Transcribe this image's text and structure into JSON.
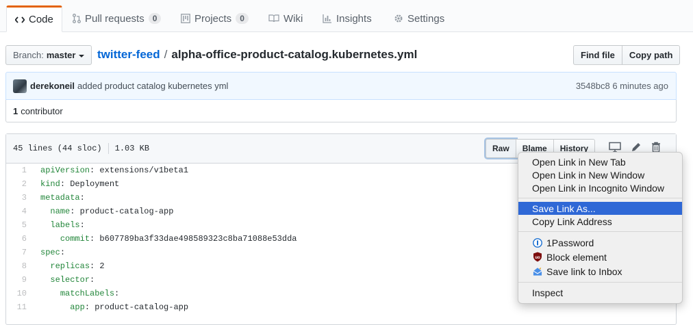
{
  "tabs": [
    {
      "label": "Code",
      "icon": "code-icon"
    },
    {
      "label": "Pull requests",
      "icon": "pull-request-icon",
      "count": "0"
    },
    {
      "label": "Projects",
      "icon": "project-icon",
      "count": "0"
    },
    {
      "label": "Wiki",
      "icon": "book-icon"
    },
    {
      "label": "Insights",
      "icon": "graph-icon"
    },
    {
      "label": "Settings",
      "icon": "gear-icon"
    }
  ],
  "branch": {
    "label": "Branch:",
    "value": "master"
  },
  "breadcrumb": {
    "repo": "twitter-feed",
    "separator": "/",
    "file": "alpha-office-product-catalog.kubernetes.yml"
  },
  "file_actions": {
    "find_file": "Find file",
    "copy_path": "Copy path"
  },
  "commit": {
    "author": "derekoneil",
    "message": "added product catalog kubernetes yml",
    "sha": "3548bc8",
    "time": "6 minutes ago"
  },
  "contributors": {
    "count": "1",
    "label": "contributor"
  },
  "file_info": {
    "lines": "45 lines (44 sloc)",
    "size": "1.03 KB"
  },
  "file_buttons": {
    "raw": "Raw",
    "blame": "Blame",
    "history": "History"
  },
  "code_lines": [
    {
      "n": "1",
      "key": "apiVersion",
      "rest": ": extensions/v1beta1"
    },
    {
      "n": "2",
      "key": "kind",
      "rest": ": Deployment"
    },
    {
      "n": "3",
      "key": "metadata",
      "rest": ":"
    },
    {
      "n": "4",
      "indent": "  ",
      "key": "name",
      "rest": ": product-catalog-app"
    },
    {
      "n": "5",
      "indent": "  ",
      "key": "labels",
      "rest": ":"
    },
    {
      "n": "6",
      "indent": "    ",
      "key": "commit",
      "rest": ": b607789ba3f33dae498589323c8ba71088e53dda"
    },
    {
      "n": "7",
      "key": "spec",
      "rest": ":"
    },
    {
      "n": "8",
      "indent": "  ",
      "key": "replicas",
      "rest": ": 2"
    },
    {
      "n": "9",
      "indent": "  ",
      "key": "selector",
      "rest": ":"
    },
    {
      "n": "10",
      "indent": "    ",
      "key": "matchLabels",
      "rest": ":"
    },
    {
      "n": "11",
      "indent": "      ",
      "key": "app",
      "rest": ": product-catalog-app"
    }
  ],
  "context_menu": {
    "group1": [
      "Open Link in New Tab",
      "Open Link in New Window",
      "Open Link in Incognito Window"
    ],
    "group2": [
      "Save Link As...",
      "Copy Link Address"
    ],
    "group3": [
      {
        "label": "1Password",
        "icon": "1password-icon"
      },
      {
        "label": "Block element",
        "icon": "ublock-icon"
      },
      {
        "label": "Save link to Inbox",
        "icon": "inbox-icon"
      }
    ],
    "group4": [
      "Inspect"
    ]
  },
  "colors": {
    "accent": "#e36209",
    "link": "#0366d6",
    "menu_highlight": "#2f68d6"
  }
}
